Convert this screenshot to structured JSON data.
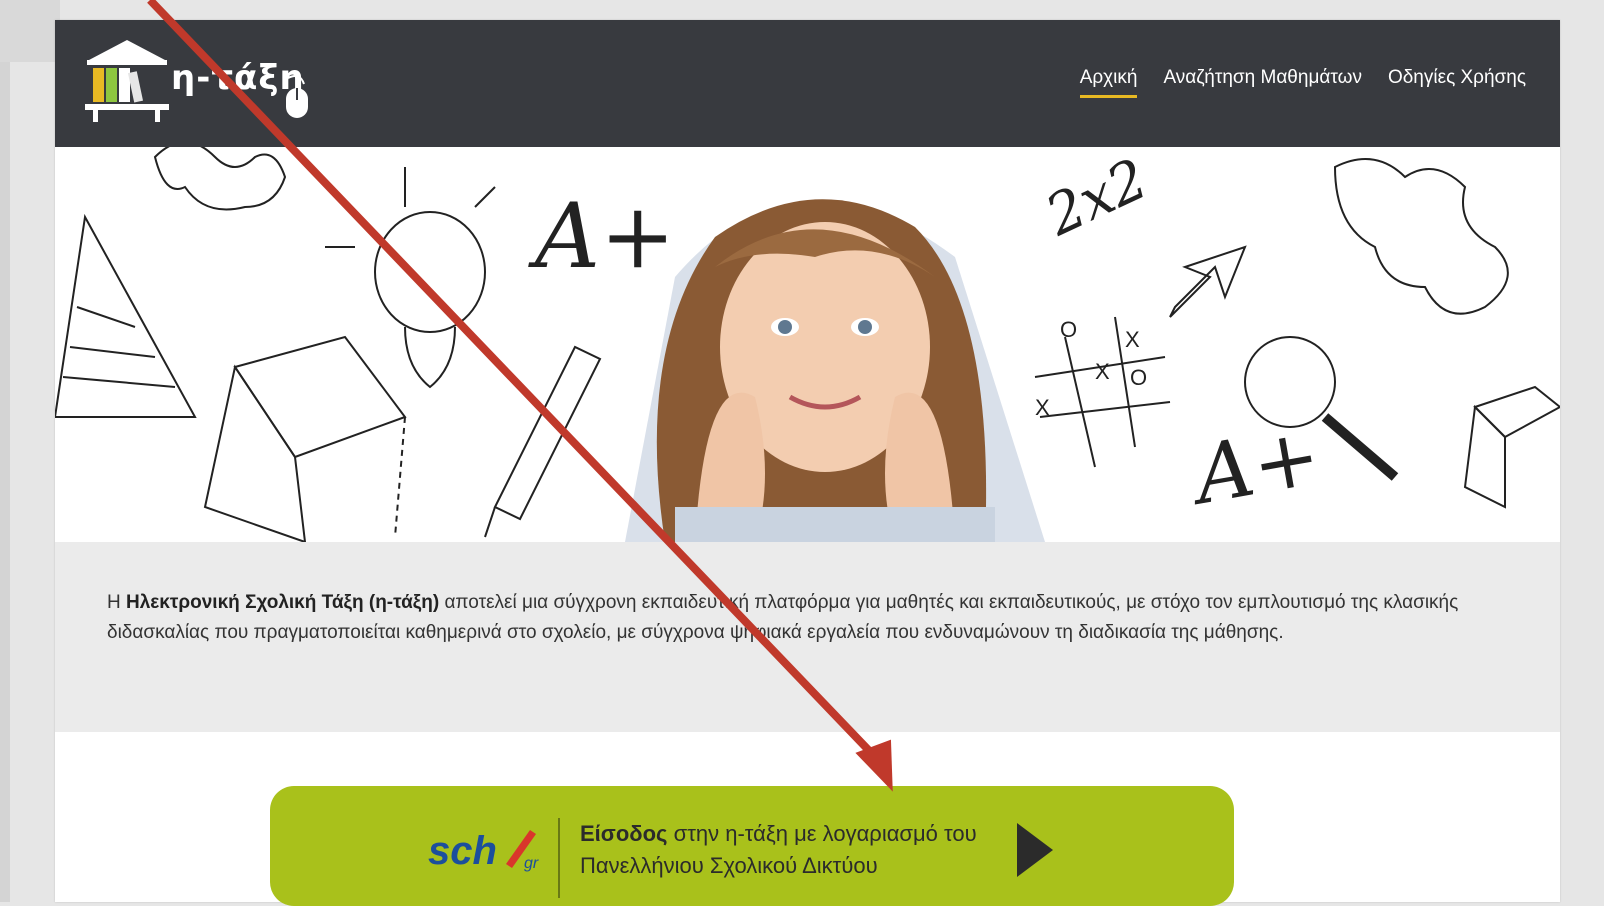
{
  "header": {
    "logo_text": "η-τάξη",
    "nav": [
      {
        "label": "Αρχική",
        "active": true
      },
      {
        "label": "Αναζήτηση Μαθημάτων",
        "active": false
      },
      {
        "label": "Οδηγίες Χρήσης",
        "active": false
      }
    ]
  },
  "hero": {
    "doodles": [
      "A+",
      "2x2",
      "A+",
      "X",
      "O",
      "X",
      "O",
      "X"
    ]
  },
  "intro": {
    "prefix": "Η ",
    "bold": "Ηλεκτρονική Σχολική Τάξη (η-τάξη)",
    "rest": " αποτελεί μια σύγχρονη εκπαιδευτική πλατφόρμα για μαθητές και εκπαιδευτικούς, με στόχο τον εμπλουτισμό της κλασικής διδασκαλίας που πραγματοποιείται καθημερινά στο σχολείο, με σύγχρονα ψηφιακά εργαλεία που ενδυναμώνουν τη διαδικασία της μάθησης."
  },
  "login": {
    "logo_text": "sch",
    "logo_suffix": "gr",
    "bold": "Είσοδος",
    "rest": " στην η-τάξη με λογαριασμό του Πανελλήνιου Σχολικού Δικτύου"
  },
  "colors": {
    "header_bg": "#383a3f",
    "nav_active_underline": "#e8b923",
    "login_bg": "#a9c11b",
    "arrow_annotation": "#c0392b",
    "intro_bg": "#ebebeb"
  }
}
